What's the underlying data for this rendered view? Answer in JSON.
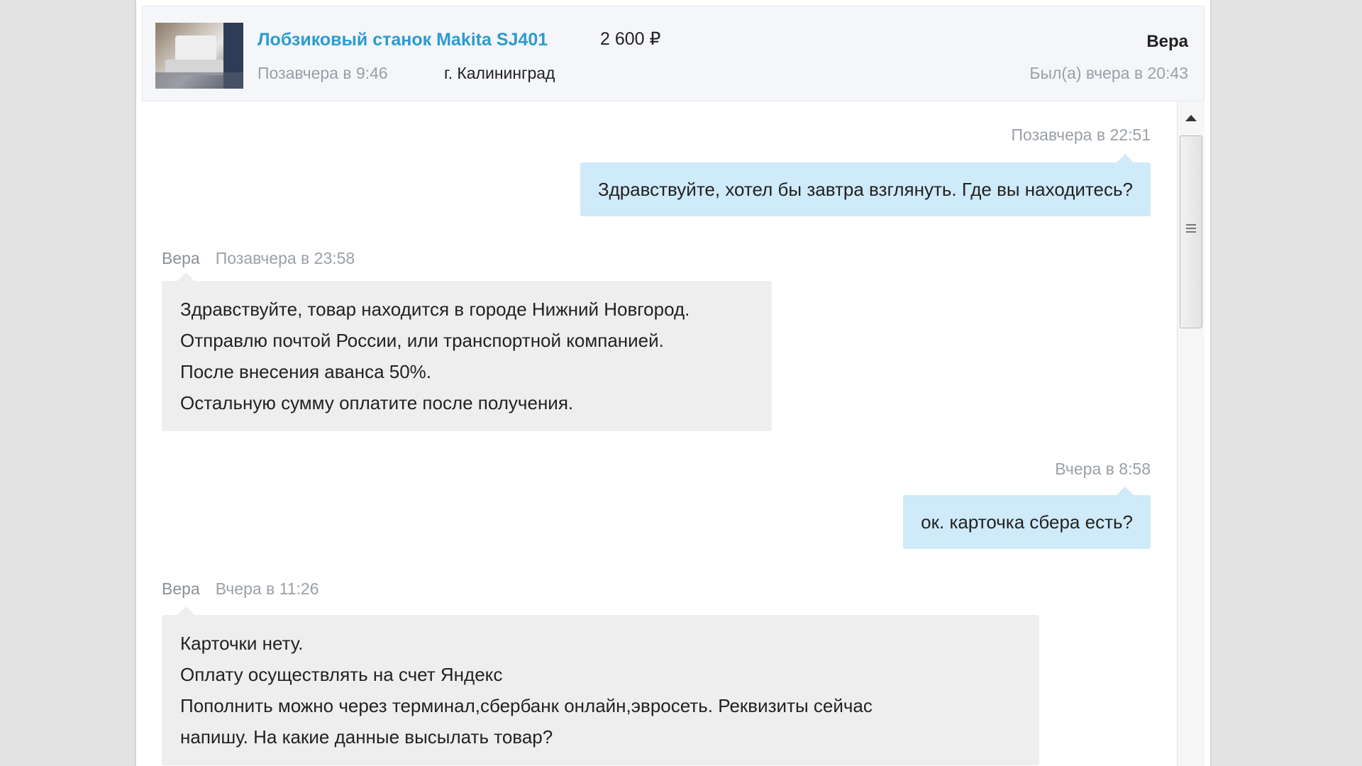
{
  "header": {
    "listing_title": "Лобзиковый станок Makita SJ401",
    "price": "2 600 ₽",
    "posted": "Позавчера в 9:46",
    "city": "г. Калининград",
    "user_name": "Вера",
    "last_seen": "Был(а) вчера в 20:43"
  },
  "messages": [
    {
      "direction": "out",
      "time": "Позавчера в 22:51",
      "lines": [
        "Здравствуйте, хотел бы завтра взглянуть. Где вы находитесь?"
      ]
    },
    {
      "direction": "in",
      "author": "Вера",
      "time": "Позавчера в 23:58",
      "lines": [
        "Здравствуйте, товар находится в городе Нижний Новгород.",
        "Отправлю почтой России, или транспортной компанией.",
        "После внесения аванса 50%.",
        "Остальную сумму оплатите после получения."
      ]
    },
    {
      "direction": "out",
      "time": "Вчера в 8:58",
      "lines": [
        "ок. карточка сбера есть?"
      ]
    },
    {
      "direction": "in",
      "author": "Вера",
      "time": "Вчера в 11:26",
      "lines": [
        "Карточки нету.",
        "Оплату осуществлять на счет Яндекс",
        "Пополнить можно через терминал,сбербанк онлайн,эвросеть. Реквизиты сейчас",
        "напишу. На какие данные высылать товар?"
      ]
    }
  ],
  "icons": {
    "scroll_up": "arrow-up-icon",
    "scroll_grip": "grip-icon",
    "thumbnail": "product-photo"
  }
}
